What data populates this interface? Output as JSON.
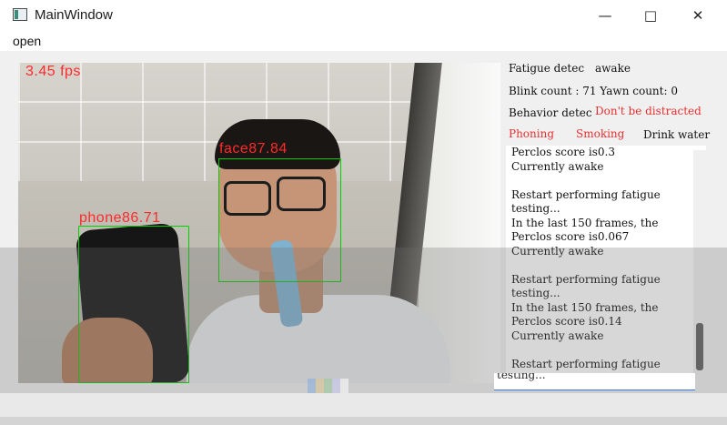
{
  "window": {
    "title": "MainWindow",
    "minimize_icon": "minimize-icon",
    "maximize_icon": "maximize-icon",
    "close_icon": "close-icon"
  },
  "menu": {
    "open": "open"
  },
  "video": {
    "fps": "3.45 fps",
    "detections": [
      {
        "label": "face87.84"
      },
      {
        "label": "phone86.71"
      }
    ]
  },
  "status": {
    "fatigue_label": "Fatigue detec",
    "fatigue_value": "awake",
    "blink_yawn": "Blink count : 71 Yawn count: 0",
    "behavior_label": "Behavior detec",
    "behavior_value": "Don't be distracted",
    "phoning": "Phoning",
    "smoking": "Smoking",
    "drink": "Drink water",
    "accent_red": "#e63030"
  },
  "log": {
    "lines": "Perclos score is0.3\nCurrently awake\n\nRestart performing fatigue\ntesting...\nIn the last 150 frames, the\nPerclos score is0.067\nCurrently awake\n\nRestart performing fatigue\ntesting...\nIn the last 150 frames, the\nPerclos score is0.14\nCurrently awake\n\nRestart performing fatigue"
  },
  "input": {
    "value": "testing..."
  }
}
